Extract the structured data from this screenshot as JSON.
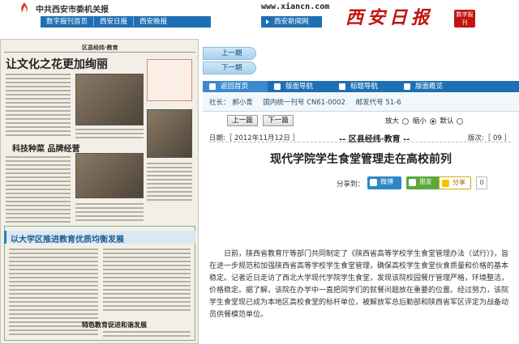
{
  "header": {
    "site_title": "中共西安市委机关报",
    "url": "www.xiancn.com",
    "nav": [
      "数字报刊首页",
      "西安日报",
      "西安晚报"
    ],
    "subnav": "西安新闻网",
    "brand": "西安日报",
    "brand_badge": "数字报刊"
  },
  "paper": {
    "page_name": "区县经纬·教育",
    "headline_main": "让文化之花更加绚丽",
    "headline_second": "科技种菜 品牌经营",
    "headline_blue": "以大学区推进教育优质均衡发展",
    "headline_bottom": "特色教育促进和谐发展"
  },
  "page_buttons": {
    "prev": "上一期",
    "next": "下一期"
  },
  "nav_tabs": [
    "返回首页",
    "版面导航",
    "标题导航",
    "版面概览"
  ],
  "pubinfo": {
    "editor": "社长： 郝小青",
    "code": "国内统一刊号 CN61-0002",
    "postal": "邮发代号 51-6"
  },
  "toolbar": {
    "prev": "上一篇",
    "next": "下一篇",
    "large": "放大",
    "small": "缩小",
    "default": "默认"
  },
  "dateline": {
    "date": "日期:［ 2012年11月12日 ］",
    "section": "-- 区县经纬·教育 --",
    "version": "版次:［ 09 ］"
  },
  "article": {
    "title": "现代学院学生食堂管理走在高校前列",
    "body": "日前，陕西省教育厅等部门共同制定了《陕西省高等学校学生食堂管理办法（试行）》，旨在进一步规范和加强陕西省高等学校学生食堂管理，确保高校学生食堂伙食质量和价格的基本稳定。记者近日走访了西北大学现代学院学生食堂，发现该院校园餐厅管理严格，环境整洁，价格稳定。据了解，该院在办学中一直把同学们的就餐问题放在重要的位置。经过努力，该院学生食堂现已成为本地区高校食堂的标杆单位，被解放军总后勤部和陕西省军区评定为战备动员供餐模范单位。"
  },
  "share": {
    "label": "分享到：",
    "wechat": "微博",
    "friends": "朋友",
    "more": "分享",
    "count": "0"
  },
  "colors": {
    "nav_blue": "#1f6fb4",
    "brand_red": "#c2140e"
  }
}
